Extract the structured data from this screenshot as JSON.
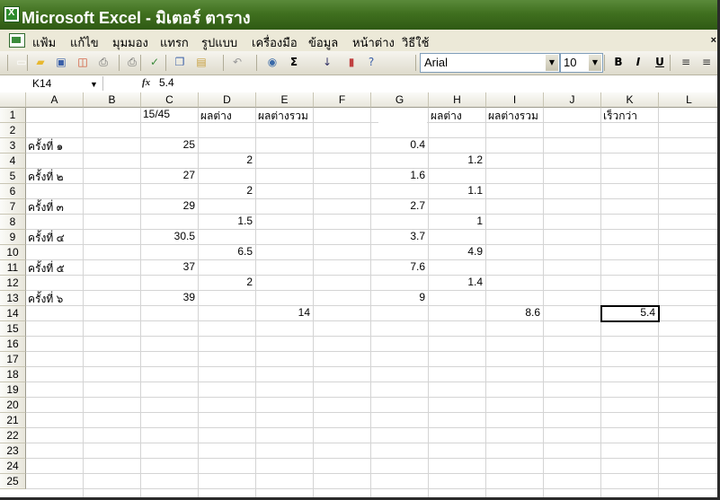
{
  "app": {
    "title": "Microsoft Excel - มิเตอร์ ตาราง"
  },
  "menu": {
    "items": [
      "แฟ้ม",
      "แก้ไข",
      "มุมมอง",
      "แทรก",
      "รูปแบบ",
      "เครื่องมือ",
      "ข้อมูล",
      "หน้าต่าง",
      "วิธีใช้"
    ],
    "close_glyph": "×"
  },
  "toolbar": {
    "icons": [
      "new-icon",
      "open-icon",
      "save-icon",
      "permission-icon",
      "print-icon",
      "print-preview-icon",
      "spelling-icon",
      "copy-icon",
      "paste-icon",
      "undo-icon",
      "hyperlink-icon",
      "autosum-icon",
      "sort-asc-icon",
      "chart-wizard-icon",
      "help-icon",
      "bold-icon",
      "italic-icon",
      "underline-icon",
      "align-left-icon",
      "align-center-icon"
    ],
    "sum_glyph": "Σ",
    "font": "Arial",
    "size": "10",
    "bold": "B",
    "italic": "I",
    "underline": "U"
  },
  "formula_bar": {
    "name_box": "K14",
    "fx": "fx",
    "value": "5.4"
  },
  "sheet": {
    "columns": [
      "A",
      "B",
      "C",
      "D",
      "E",
      "F",
      "G",
      "H",
      "I",
      "J",
      "K",
      "L"
    ],
    "rows": [
      "1",
      "2",
      "3",
      "4",
      "5",
      "6",
      "7",
      "8",
      "9",
      "10",
      "11",
      "12",
      "13",
      "14",
      "15",
      "16",
      "17",
      "18",
      "19",
      "20",
      "21",
      "22",
      "23",
      "24",
      "25"
    ],
    "selected_cell": "K14",
    "cells": [
      {
        "row": 1,
        "col": "C",
        "value": "15/45",
        "align": "left"
      },
      {
        "row": 1,
        "col": "D",
        "value": "ผลต่าง",
        "align": "left"
      },
      {
        "row": 1,
        "col": "E",
        "value": "ผลต่างรวม",
        "align": "left"
      },
      {
        "row": 1,
        "col": "H",
        "value": "ผลต่าง",
        "align": "left"
      },
      {
        "row": 1,
        "col": "I",
        "value": "ผลต่างรวม",
        "align": "left"
      },
      {
        "row": 1,
        "col": "K",
        "value": "เร็วกว่า",
        "align": "left"
      },
      {
        "row": 3,
        "col": "A",
        "value": "ครั้งที่ ๑",
        "align": "left"
      },
      {
        "row": 3,
        "col": "C",
        "value": "25",
        "align": "right"
      },
      {
        "row": 3,
        "col": "G",
        "value": "0.4",
        "align": "right"
      },
      {
        "row": 4,
        "col": "D",
        "value": "2",
        "align": "right"
      },
      {
        "row": 4,
        "col": "H",
        "value": "1.2",
        "align": "right"
      },
      {
        "row": 5,
        "col": "A",
        "value": "ครั้งที่ ๒",
        "align": "left"
      },
      {
        "row": 5,
        "col": "C",
        "value": "27",
        "align": "right"
      },
      {
        "row": 5,
        "col": "G",
        "value": "1.6",
        "align": "right"
      },
      {
        "row": 6,
        "col": "D",
        "value": "2",
        "align": "right"
      },
      {
        "row": 6,
        "col": "H",
        "value": "1.1",
        "align": "right"
      },
      {
        "row": 7,
        "col": "A",
        "value": "ครั้งที่ ๓",
        "align": "left"
      },
      {
        "row": 7,
        "col": "C",
        "value": "29",
        "align": "right"
      },
      {
        "row": 7,
        "col": "G",
        "value": "2.7",
        "align": "right"
      },
      {
        "row": 8,
        "col": "D",
        "value": "1.5",
        "align": "right"
      },
      {
        "row": 8,
        "col": "H",
        "value": "1",
        "align": "right"
      },
      {
        "row": 9,
        "col": "A",
        "value": "ครั้งที่ ๔",
        "align": "left"
      },
      {
        "row": 9,
        "col": "C",
        "value": "30.5",
        "align": "right"
      },
      {
        "row": 9,
        "col": "G",
        "value": "3.7",
        "align": "right"
      },
      {
        "row": 10,
        "col": "D",
        "value": "6.5",
        "align": "right"
      },
      {
        "row": 10,
        "col": "H",
        "value": "4.9",
        "align": "right"
      },
      {
        "row": 11,
        "col": "A",
        "value": "ครั้งที่ ๕",
        "align": "left"
      },
      {
        "row": 11,
        "col": "C",
        "value": "37",
        "align": "right"
      },
      {
        "row": 11,
        "col": "G",
        "value": "7.6",
        "align": "right"
      },
      {
        "row": 12,
        "col": "D",
        "value": "2",
        "align": "right"
      },
      {
        "row": 12,
        "col": "H",
        "value": "1.4",
        "align": "right"
      },
      {
        "row": 13,
        "col": "A",
        "value": "ครั้งที่ ๖",
        "align": "left"
      },
      {
        "row": 13,
        "col": "C",
        "value": "39",
        "align": "right"
      },
      {
        "row": 13,
        "col": "G",
        "value": "9",
        "align": "right"
      },
      {
        "row": 14,
        "col": "E",
        "value": "14",
        "align": "right"
      },
      {
        "row": 14,
        "col": "I",
        "value": "8.6",
        "align": "right"
      },
      {
        "row": 14,
        "col": "K",
        "value": "5.4",
        "align": "right"
      }
    ]
  },
  "colors": {
    "titlebar": "#40701f",
    "grid_line": "#d4d4d4",
    "header_bg": "#ece9d8"
  }
}
